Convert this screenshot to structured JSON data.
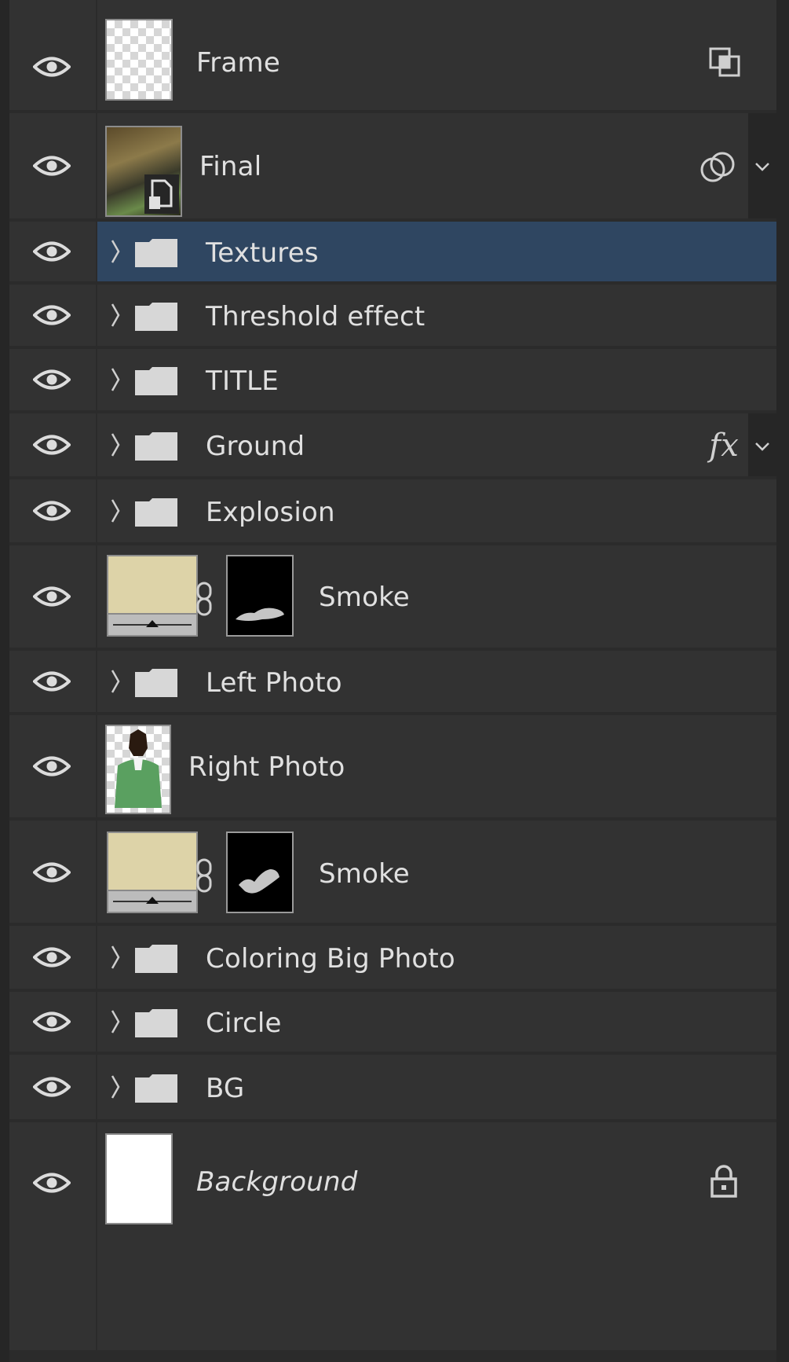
{
  "layers": [
    {
      "name": "Frame",
      "type": "smart-frame"
    },
    {
      "name": "Final",
      "type": "smart-object",
      "badge": "linked-layers-icon"
    },
    {
      "name": "Textures",
      "type": "group",
      "selected": true
    },
    {
      "name": "Threshold effect",
      "type": "group"
    },
    {
      "name": "TITLE",
      "type": "group"
    },
    {
      "name": "Ground",
      "type": "group",
      "badge": "fx"
    },
    {
      "name": "Explosion",
      "type": "group"
    },
    {
      "name": "Smoke",
      "type": "adjustment-with-mask",
      "fill_color": "#ddd3a8"
    },
    {
      "name": "Left Photo",
      "type": "group"
    },
    {
      "name": "Right Photo",
      "type": "pixel"
    },
    {
      "name": "Smoke",
      "type": "adjustment-with-mask",
      "fill_color": "#ddd3a8"
    },
    {
      "name": "Coloring Big Photo",
      "type": "group"
    },
    {
      "name": "Circle",
      "type": "group"
    },
    {
      "name": "BG",
      "type": "group"
    },
    {
      "name": "Background",
      "type": "background",
      "locked": true
    }
  ],
  "badges": {
    "fx_label": "fx"
  },
  "colors": {
    "panel": "#2b2b2b",
    "row": "#323232",
    "selected": "#2f4661",
    "text": "#e0e0e0"
  }
}
